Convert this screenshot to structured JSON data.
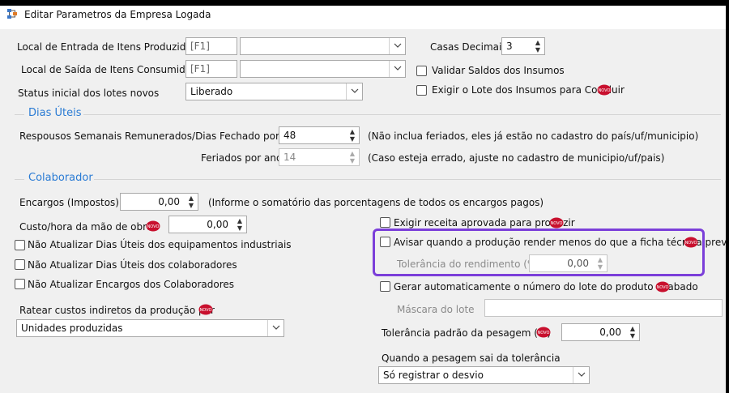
{
  "window": {
    "title": "Editar Parametros da Empresa Logada"
  },
  "colors": {
    "section": "#2a7bd4",
    "highlight": "#7b3fd9",
    "novo_badge": "#c8102e"
  },
  "top": {
    "entrada": {
      "label": "Local de Entrada de Itens Produzidos",
      "code": "[F1]",
      "value": ""
    },
    "saida": {
      "label": "Local de Saída de Itens Consumidos",
      "code": "[F1]",
      "value": ""
    },
    "status": {
      "label": "Status inicial dos lotes novos",
      "value": "Liberado"
    },
    "casas": {
      "label": "Casas Decimais",
      "value": "3"
    },
    "validar": {
      "label": "Validar Saldos dos Insumos",
      "checked": false
    },
    "exigir_lote": {
      "label": "Exigir o Lote dos Insumos para Concluir",
      "checked": false
    }
  },
  "dias_uteis": {
    "title": "Dias Úteis",
    "repousos": {
      "label": "Respousos Semanais Remunerados/Dias Fechado por ano",
      "value": "48",
      "note": "(Não inclua feriados, eles já estão no cadastro do país/uf/municipio)"
    },
    "feriados": {
      "label": "Feriados por ano",
      "value": "14",
      "note": "(Caso esteja errado, ajuste no cadastro de municipio/uf/pais)"
    }
  },
  "colaborador": {
    "title": "Colaborador",
    "encargos": {
      "label": "Encargos (Impostos)",
      "value": "0,00",
      "note": "(Informe o somatório das porcentagens de todos os encargos pagos)"
    },
    "custo_hora": {
      "label": "Custo/hora da mão de obra:",
      "value": "0,00"
    },
    "nao_dias_equip": {
      "label": "Não Atualizar Dias Úteis dos equipamentos industriais",
      "checked": false
    },
    "nao_dias_colab": {
      "label": "Não Atualizar Dias Úteis dos colaboradores",
      "checked": false
    },
    "nao_encargos": {
      "label": "Não Atualizar Encargos dos Colaboradores",
      "checked": false
    },
    "ratear": {
      "label": "Ratear custos indiretos da produção por",
      "value": "Unidades produzidas"
    }
  },
  "producao": {
    "exigir_receita": {
      "label": "Exigir receita aprovada para produzir",
      "checked": false
    },
    "avisar": {
      "label": "Avisar quando a produção render menos do que a ficha técnica previa",
      "checked": false
    },
    "tolerancia_rend": {
      "label": "Tolerância do rendimento (%)",
      "value": "0,00"
    },
    "gerar_lote": {
      "label": "Gerar automaticamente o número do lote do produto acabado",
      "checked": false
    },
    "mascara": {
      "label": "Máscara do lote",
      "value": ""
    },
    "tolerancia_pesagem": {
      "label": "Tolerância padrão da pesagem (%)",
      "value": "0,00"
    },
    "quando_pesagem": {
      "label": "Quando a pesagem sai da tolerância",
      "value": "Só registrar o desvio"
    }
  },
  "badge_text": "NOVO"
}
